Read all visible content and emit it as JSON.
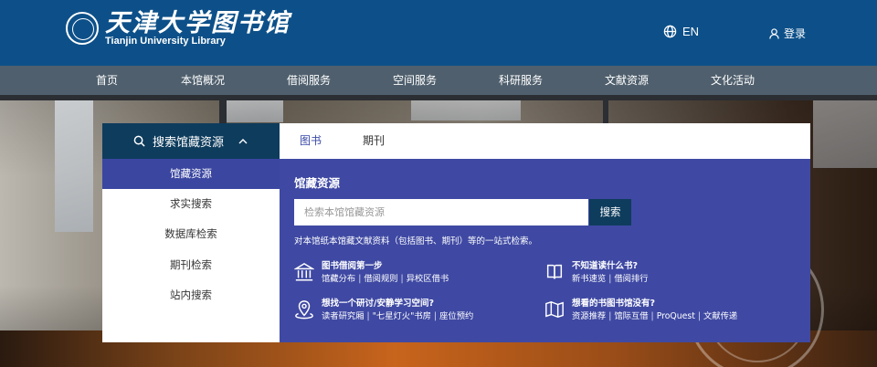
{
  "header": {
    "logo_cn": "天津大学图书馆",
    "logo_en": "Tianjin University Library",
    "lang_label": "EN",
    "login_label": "登录"
  },
  "nav": {
    "items": [
      "首页",
      "本馆概况",
      "借阅服务",
      "空间服务",
      "科研服务",
      "文献资源",
      "文化活动"
    ]
  },
  "search_panel": {
    "header_label": "搜索馆藏资源",
    "tabs": [
      {
        "label": "图书",
        "active": true
      },
      {
        "label": "期刊",
        "active": false
      }
    ],
    "side_items": [
      {
        "label": "馆藏资源",
        "active": true
      },
      {
        "label": "求实搜索",
        "active": false
      },
      {
        "label": "数据库检索",
        "active": false
      },
      {
        "label": "期刊检索",
        "active": false
      },
      {
        "label": "站内搜索",
        "active": false
      }
    ],
    "main_title": "馆藏资源",
    "input_placeholder": "检索本馆馆藏资源",
    "search_button": "搜索",
    "description": "对本馆纸本馆藏文献资料（包括图书、期刊）等的一站式检索。"
  },
  "features": [
    {
      "icon": "library-building-icon",
      "title": "图书借阅第一步",
      "links": [
        "馆藏分布",
        "借阅规则",
        "异校区借书"
      ]
    },
    {
      "icon": "book-question-icon",
      "title": "不知道读什么书?",
      "links": [
        "新书速览",
        "借阅排行"
      ]
    },
    {
      "icon": "location-pin-icon",
      "title": "想找一个研讨/安静学习空间?",
      "links": [
        "读者研究厢",
        "\"七星灯火\"书房",
        "座位预约"
      ]
    },
    {
      "icon": "open-book-icon",
      "title": "想看的书图书馆没有?",
      "links": [
        "资源推荐",
        "馆际互借",
        "ProQuest",
        "文献传递"
      ]
    }
  ],
  "colors": {
    "header_bg": "#0d5089",
    "nav_bg": "#4f5f6d",
    "panel_accent": "#3f49a3",
    "panel_dark": "#0e3c5d"
  }
}
